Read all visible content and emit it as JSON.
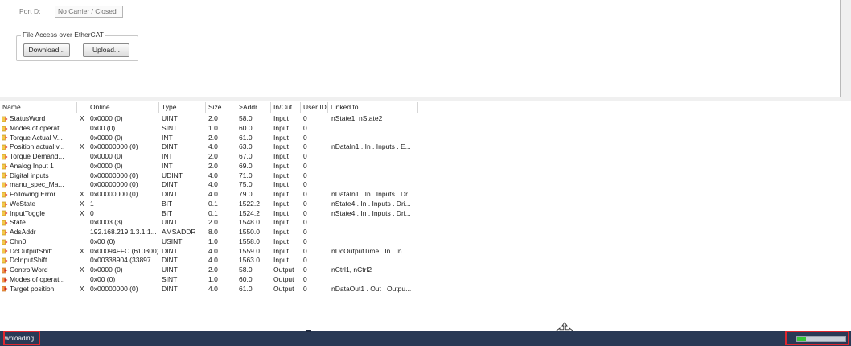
{
  "top_panel": {
    "port_d_label": "Port D:",
    "port_d_value": "No Carrier / Closed",
    "file_access_title": "File Access over EtherCAT",
    "download_label": "Download...",
    "upload_label": "Upload..."
  },
  "var_list": {
    "columns": {
      "name": "Name",
      "online": "Online",
      "type": "Type",
      "size": "Size",
      "addr": ">Addr...",
      "inout": "In/Out",
      "userid": "User ID",
      "linked": "Linked to"
    },
    "rows": [
      {
        "name": "StatusWord",
        "x": "X",
        "online": "0x0000 (0)",
        "type": "UINT",
        "size": "2.0",
        "addr": "58.0",
        "inout": "Input",
        "userid": "0",
        "linked": "nState1, nState2",
        "icon": "input-variable-icon"
      },
      {
        "name": "Modes of operat...",
        "x": "",
        "online": "0x00 (0)",
        "type": "SINT",
        "size": "1.0",
        "addr": "60.0",
        "inout": "Input",
        "userid": "0",
        "linked": "",
        "icon": "input-variable-icon"
      },
      {
        "name": "Torque Actual V...",
        "x": "",
        "online": "0x0000 (0)",
        "type": "INT",
        "size": "2.0",
        "addr": "61.0",
        "inout": "Input",
        "userid": "0",
        "linked": "",
        "icon": "input-variable-icon"
      },
      {
        "name": "Position actual v...",
        "x": "X",
        "online": "0x00000000 (0)",
        "type": "DINT",
        "size": "4.0",
        "addr": "63.0",
        "inout": "Input",
        "userid": "0",
        "linked": "nDataIn1 . In . Inputs . E...",
        "icon": "input-variable-icon"
      },
      {
        "name": "Torque Demand...",
        "x": "",
        "online": "0x0000 (0)",
        "type": "INT",
        "size": "2.0",
        "addr": "67.0",
        "inout": "Input",
        "userid": "0",
        "linked": "",
        "icon": "input-variable-icon"
      },
      {
        "name": "Analog Input 1",
        "x": "",
        "online": "0x0000 (0)",
        "type": "INT",
        "size": "2.0",
        "addr": "69.0",
        "inout": "Input",
        "userid": "0",
        "linked": "",
        "icon": "input-variable-icon"
      },
      {
        "name": "Digital inputs",
        "x": "",
        "online": "0x00000000 (0)",
        "type": "UDINT",
        "size": "4.0",
        "addr": "71.0",
        "inout": "Input",
        "userid": "0",
        "linked": "",
        "icon": "input-variable-icon"
      },
      {
        "name": "manu_spec_Ma...",
        "x": "",
        "online": "0x00000000 (0)",
        "type": "DINT",
        "size": "4.0",
        "addr": "75.0",
        "inout": "Input",
        "userid": "0",
        "linked": "",
        "icon": "input-variable-icon"
      },
      {
        "name": "Following Error ...",
        "x": "X",
        "online": "0x00000000 (0)",
        "type": "DINT",
        "size": "4.0",
        "addr": "79.0",
        "inout": "Input",
        "userid": "0",
        "linked": "nDataIn1 . In . Inputs . Dr...",
        "icon": "input-variable-icon"
      },
      {
        "name": "WcState",
        "x": "X",
        "online": "1",
        "type": "BIT",
        "size": "0.1",
        "addr": "1522.2",
        "inout": "Input",
        "userid": "0",
        "linked": "nState4 . In . Inputs . Dri...",
        "icon": "input-variable-icon"
      },
      {
        "name": "InputToggle",
        "x": "X",
        "online": "0",
        "type": "BIT",
        "size": "0.1",
        "addr": "1524.2",
        "inout": "Input",
        "userid": "0",
        "linked": "nState4 . In . Inputs . Dri...",
        "icon": "input-variable-icon"
      },
      {
        "name": "State",
        "x": "",
        "online": "0x0003 (3)",
        "type": "UINT",
        "size": "2.0",
        "addr": "1548.0",
        "inout": "Input",
        "userid": "0",
        "linked": "",
        "icon": "input-variable-icon"
      },
      {
        "name": "AdsAddr",
        "x": "",
        "online": "192.168.219.1.3.1:1...",
        "type": "AMSADDR",
        "size": "8.0",
        "addr": "1550.0",
        "inout": "Input",
        "userid": "0",
        "linked": "",
        "icon": "input-variable-icon"
      },
      {
        "name": "Chn0",
        "x": "",
        "online": "0x00 (0)",
        "type": "USINT",
        "size": "1.0",
        "addr": "1558.0",
        "inout": "Input",
        "userid": "0",
        "linked": "",
        "icon": "input-variable-icon"
      },
      {
        "name": "DcOutputShift",
        "x": "X",
        "online": "0x00094FFC (610300)",
        "type": "DINT",
        "size": "4.0",
        "addr": "1559.0",
        "inout": "Input",
        "userid": "0",
        "linked": "nDcOutputTime . In . In...",
        "icon": "input-variable-icon"
      },
      {
        "name": "DcInputShift",
        "x": "",
        "online": "0x00338904 (33897...",
        "type": "DINT",
        "size": "4.0",
        "addr": "1563.0",
        "inout": "Input",
        "userid": "0",
        "linked": "",
        "icon": "input-variable-icon"
      },
      {
        "name": "ControlWord",
        "x": "X",
        "online": "0x0000 (0)",
        "type": "UINT",
        "size": "2.0",
        "addr": "58.0",
        "inout": "Output",
        "userid": "0",
        "linked": "nCtrl1, nCtrl2",
        "icon": "output-variable-icon"
      },
      {
        "name": "Modes of operat...",
        "x": "",
        "online": "0x00 (0)",
        "type": "SINT",
        "size": "1.0",
        "addr": "60.0",
        "inout": "Output",
        "userid": "0",
        "linked": "",
        "icon": "output-variable-icon"
      },
      {
        "name": "Target position",
        "x": "X",
        "online": "0x00000000 (0)",
        "type": "DINT",
        "size": "4.0",
        "addr": "61.0",
        "inout": "Output",
        "userid": "0",
        "linked": "nDataOut1 . Out . Outpu...",
        "icon": "output-variable-icon"
      }
    ]
  },
  "status_bar": {
    "text": "wnloading...",
    "progress": 0.18,
    "bg_color": "#293955",
    "highlight_color": "#e0262e",
    "progress_color": "#37c437"
  }
}
